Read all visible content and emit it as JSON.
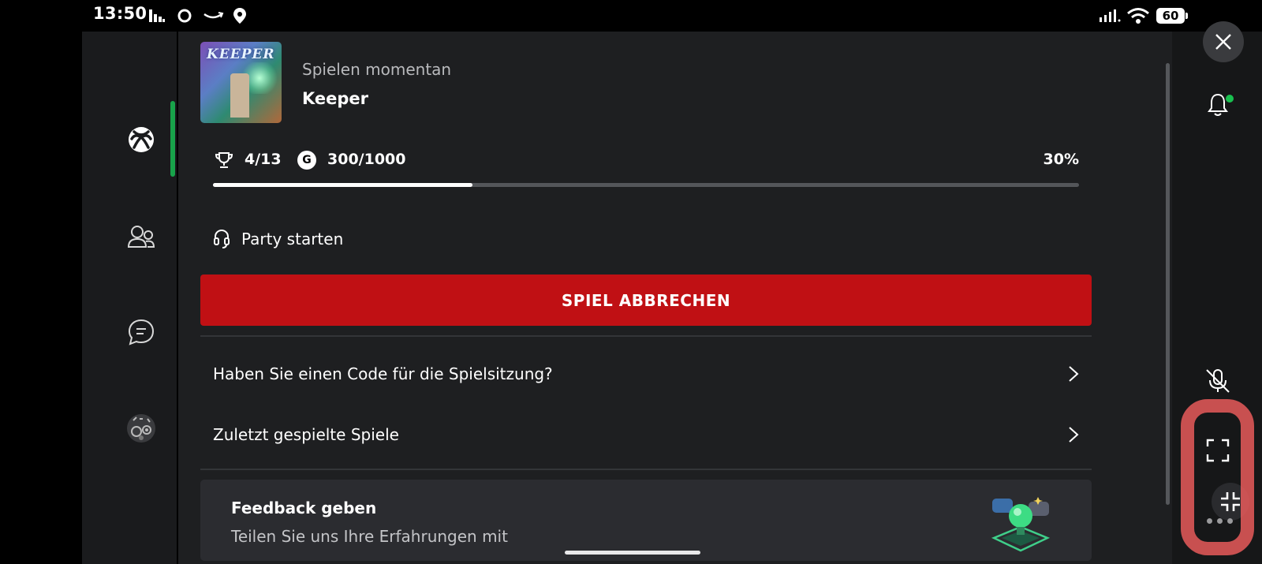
{
  "status_bar": {
    "time": "13:50",
    "battery": "60"
  },
  "game": {
    "cover_title": "KEEPER",
    "playing_label": "Spielen momentan",
    "title": "Keeper",
    "achievements": "4/13",
    "gamerscore_icon_letter": "G",
    "gamerscore": "300/1000",
    "progress_percent_label": "30%",
    "progress": 0.3
  },
  "actions": {
    "party_label": "Party starten",
    "quit_label": "SPIEL ABBRECHEN"
  },
  "list": [
    {
      "label": "Haben Sie einen Code für die Spielsitzung?"
    },
    {
      "label": "Zuletzt gespielte Spiele"
    }
  ],
  "feedback": {
    "title": "Feedback geben",
    "subtitle": "Teilen Sie uns Ihre Erfahrungen mit"
  },
  "nav": [
    "xbox-icon",
    "people-icon",
    "chat-icon",
    "achievements-icon"
  ],
  "colors": {
    "accent_green": "#18a34a",
    "quit_red": "#c01014",
    "annotation": "#e85a5a"
  }
}
